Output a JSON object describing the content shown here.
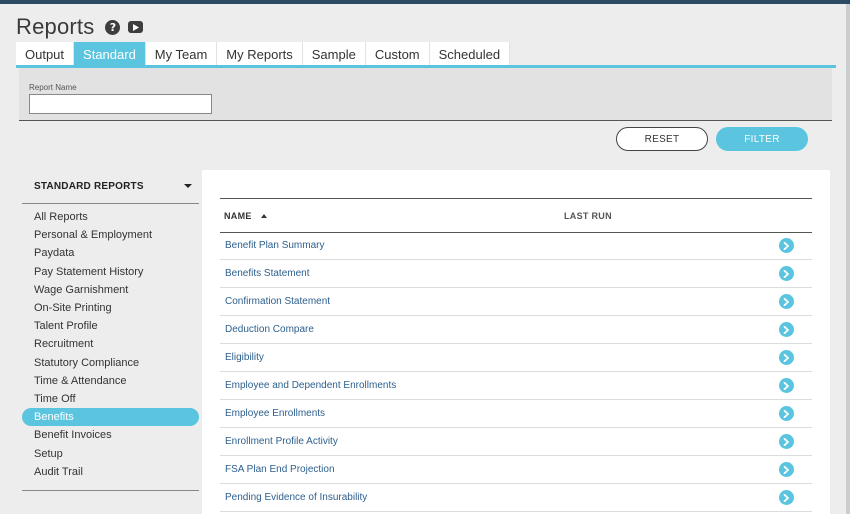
{
  "page": {
    "title": "Reports"
  },
  "icons": {
    "help": "help-icon",
    "video": "video-icon",
    "row_action": "chevron-right-icon",
    "sort": "caret-up-icon",
    "menu": "caret-down-icon"
  },
  "colors": {
    "accent": "#5bc5e0",
    "top_bar": "#2c4a63",
    "link": "#2d5f8e"
  },
  "tabs": [
    {
      "label": "Output",
      "active": false
    },
    {
      "label": "Standard",
      "active": true
    },
    {
      "label": "My Team",
      "active": false
    },
    {
      "label": "My Reports",
      "active": false
    },
    {
      "label": "Sample",
      "active": false
    },
    {
      "label": "Custom",
      "active": false
    },
    {
      "label": "Scheduled",
      "active": false
    }
  ],
  "filter": {
    "report_name_label": "Report Name",
    "report_name_value": "",
    "reset_label": "RESET",
    "filter_label": "FILTER"
  },
  "sidebar": {
    "header": "STANDARD REPORTS",
    "items": [
      {
        "label": "All Reports"
      },
      {
        "label": "Personal & Employment"
      },
      {
        "label": "Paydata"
      },
      {
        "label": "Pay Statement History"
      },
      {
        "label": "Wage Garnishment"
      },
      {
        "label": "On-Site Printing"
      },
      {
        "label": "Talent Profile"
      },
      {
        "label": "Recruitment"
      },
      {
        "label": "Statutory Compliance"
      },
      {
        "label": "Time & Attendance"
      },
      {
        "label": "Time Off"
      },
      {
        "label": "Benefits",
        "active": true
      },
      {
        "label": "Benefit Invoices"
      },
      {
        "label": "Setup"
      },
      {
        "label": "Audit Trail"
      }
    ]
  },
  "table": {
    "columns": {
      "name": "NAME",
      "last_run": "LAST RUN"
    },
    "rows": [
      {
        "name": "Benefit Plan Summary",
        "last_run": ""
      },
      {
        "name": "Benefits Statement",
        "last_run": ""
      },
      {
        "name": "Confirmation Statement",
        "last_run": ""
      },
      {
        "name": "Deduction Compare",
        "last_run": ""
      },
      {
        "name": "Eligibility",
        "last_run": ""
      },
      {
        "name": "Employee and Dependent Enrollments",
        "last_run": ""
      },
      {
        "name": "Employee Enrollments",
        "last_run": ""
      },
      {
        "name": "Enrollment Profile Activity",
        "last_run": ""
      },
      {
        "name": "FSA Plan End Projection",
        "last_run": ""
      },
      {
        "name": "Pending Evidence of Insurability",
        "last_run": ""
      }
    ]
  }
}
